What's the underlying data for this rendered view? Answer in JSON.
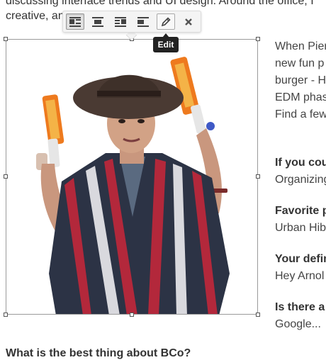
{
  "article": {
    "intro_line1": "discussing interface trends and UI design. Around the office, I",
    "intro_line2": "creative, an                              scared) at times!",
    "right_column": [
      {
        "text": "When Pier",
        "q": false
      },
      {
        "text": "new fun p",
        "q": false
      },
      {
        "text": "burger - H",
        "q": false
      },
      {
        "text": "EDM phas",
        "q": false
      },
      {
        "text": "Find a few",
        "q": false
      },
      {
        "text": "If you cou",
        "q": true
      },
      {
        "text": "Organizing",
        "q": false
      },
      {
        "text": "Favorite p",
        "q": true
      },
      {
        "text": "Urban Hib",
        "q": false
      },
      {
        "text": "Your defin",
        "q": true
      },
      {
        "text": "Hey Arnol",
        "q": false
      },
      {
        "text": "Is there a",
        "q": true
      },
      {
        "text": "Google...",
        "q": false
      }
    ],
    "bottom_question": "What is the best thing about BCo?"
  },
  "image_toolbar": {
    "buttons": [
      {
        "name": "align-left-button",
        "icon": "align-left-icon"
      },
      {
        "name": "align-center-button",
        "icon": "align-center-icon"
      },
      {
        "name": "align-right-button",
        "icon": "align-right-icon"
      },
      {
        "name": "align-none-button",
        "icon": "align-none-icon"
      },
      {
        "name": "edit-button",
        "icon": "pencil-icon"
      },
      {
        "name": "remove-button",
        "icon": "close-icon"
      }
    ],
    "tooltip": "Edit"
  },
  "colors": {
    "poncho_red": "#b3283b",
    "poncho_navy": "#2c3345",
    "hat_brown": "#4a3a33",
    "blaster_orange": "#ee7a1e"
  }
}
